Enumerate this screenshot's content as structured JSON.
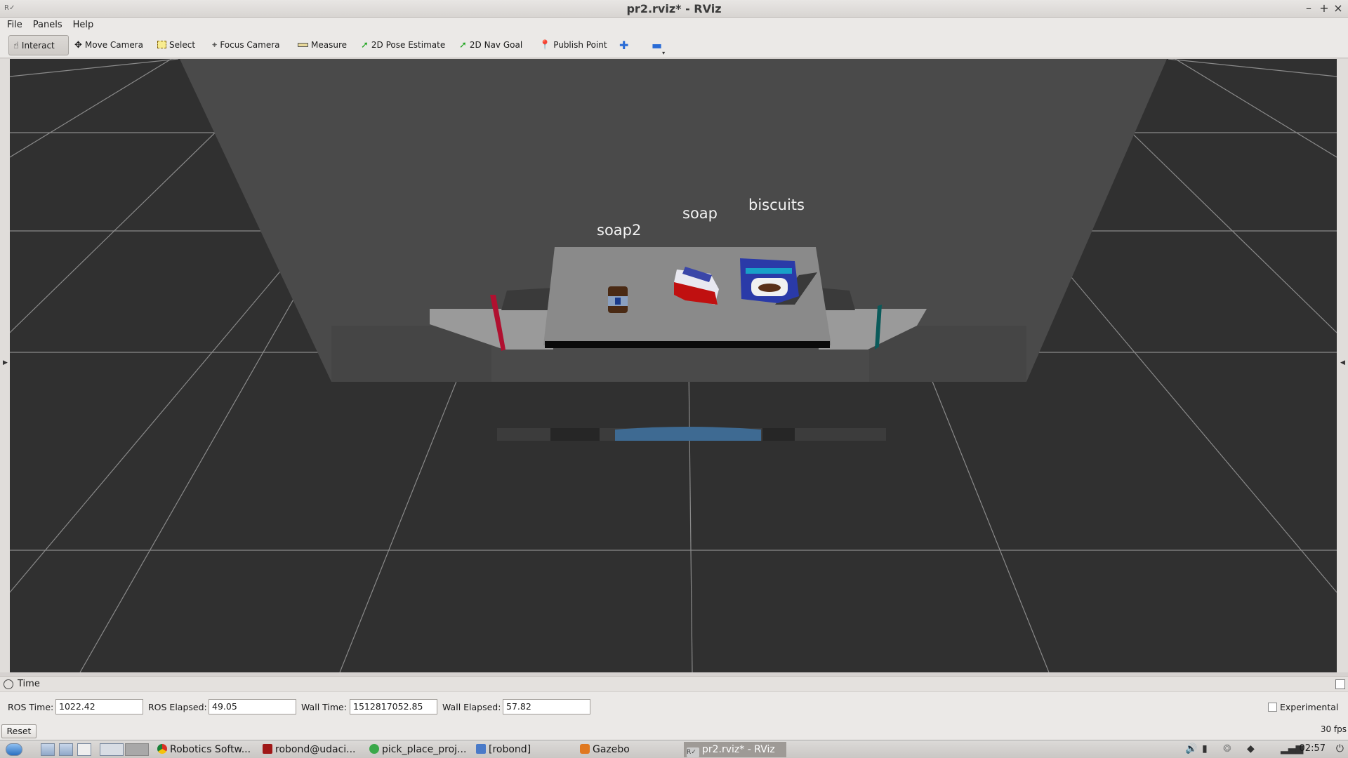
{
  "window": {
    "title": "pr2.rviz* - RViz",
    "app_icon": "rviz-icon",
    "controls": [
      "–",
      "+",
      "×"
    ]
  },
  "menu": [
    "File",
    "Panels",
    "Help"
  ],
  "toolbar": {
    "tools": [
      {
        "label": "Interact",
        "icon": "hand-icon",
        "active": true
      },
      {
        "label": "Move Camera",
        "icon": "move-camera-icon"
      },
      {
        "label": "Select",
        "icon": "select-icon"
      },
      {
        "label": "Focus Camera",
        "icon": "focus-camera-icon"
      },
      {
        "label": "Measure",
        "icon": "ruler-icon"
      },
      {
        "label": "2D Pose Estimate",
        "icon": "green-arrow-icon"
      },
      {
        "label": "2D Nav Goal",
        "icon": "green-arrow-icon"
      },
      {
        "label": "Publish Point",
        "icon": "pin-icon"
      }
    ],
    "add_icon": "plus-icon",
    "remove_icon": "minus-icon"
  },
  "scene": {
    "labels": [
      "soap2",
      "soap",
      "biscuits"
    ],
    "background": "#303030",
    "grid_color": "#9a9a9a"
  },
  "time_panel": {
    "title": "Time",
    "ros_time_label": "ROS Time:",
    "ros_time": "1022.42",
    "ros_elapsed_label": "ROS Elapsed:",
    "ros_elapsed": "49.05",
    "wall_time_label": "Wall Time:",
    "wall_time": "1512817052.85",
    "wall_elapsed_label": "Wall Elapsed:",
    "wall_elapsed": "57.82",
    "experimental_label": "Experimental",
    "experimental_checked": false
  },
  "status": {
    "reset_label": "Reset",
    "fps": "30 fps"
  },
  "taskbar": {
    "tasks": [
      {
        "label": "Robotics Softw...",
        "icon": "chrome-icon"
      },
      {
        "label": "robond@udaci...",
        "icon": "terminal-icon"
      },
      {
        "label": "pick_place_proj...",
        "icon": "globe-icon"
      },
      {
        "label": "[robond]",
        "icon": "folder-icon"
      },
      {
        "label": "Gazebo",
        "icon": "gazebo-icon"
      },
      {
        "label": "pr2.rviz* - RViz",
        "icon": "rviz-icon",
        "active": true
      }
    ],
    "clock": "02:57"
  }
}
